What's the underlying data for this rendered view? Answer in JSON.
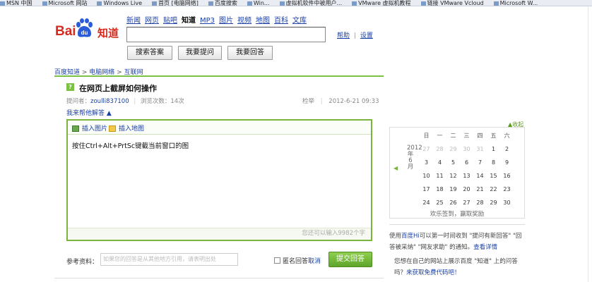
{
  "browser_tabs": [
    "MSN 中国",
    "Microsoft 网站",
    "Windows Live",
    "首页 [电脑网络]",
    "百度搜索",
    "Win...",
    "虚拟机软件中被用户...",
    "VMware 虚拟机教程",
    "链接 VMware Vcloud",
    "Microsoft W..."
  ],
  "logo": {
    "bai": "Bai",
    "du": "du",
    "zhidao": "知道"
  },
  "nav": [
    "新闻",
    "网页",
    "贴吧",
    "知道",
    "MP3",
    "图片",
    "视频",
    "地图",
    "百科",
    "文库"
  ],
  "search": {
    "value": ""
  },
  "help_links": {
    "help": "帮助",
    "sep": "|",
    "settings": "设置"
  },
  "buttons": {
    "search": "搜索答案",
    "ask": "我要提问",
    "answer": "我要回答"
  },
  "breadcrumb": {
    "home": "百度知道",
    "sep1": " > ",
    "cat": "电脑网络",
    "sep2": " > ",
    "sub": "互联网"
  },
  "question": {
    "icon": "?",
    "title": "在网页上截屏如何操作",
    "asker_label": "提问者：",
    "asker": "zoulli837100",
    "views": "浏览次数：14次",
    "report": "检举",
    "date": "2012-6-21 09:33"
  },
  "i_help": "我来帮他解答 ▲",
  "editor": {
    "insert_image": "插入图片",
    "insert_map": "插入地图",
    "content": "按住Ctrl+Alt+PrtSc键截当前窗口的图",
    "counter": "您还可以输入9982个字"
  },
  "reference": {
    "label": "参考资料：",
    "placeholder": "如果您的回答是从其他地方引用，请表明出处"
  },
  "anonymous": {
    "label": "匿名回答",
    "cancel": "取消"
  },
  "submit_label": "提交回答",
  "sidebar": {
    "collapse": "▲收起",
    "calendar": {
      "year": "2012年6月",
      "weekdays": [
        "日",
        "一",
        "二",
        "三",
        "四",
        "五",
        "六"
      ],
      "weeks": [
        [
          "27",
          "28",
          "29",
          "30",
          "31",
          "1",
          "2"
        ],
        [
          "3",
          "4",
          "5",
          "6",
          "7",
          "8",
          "9"
        ],
        [
          "10",
          "11",
          "12",
          "13",
          "14",
          "15",
          "16"
        ],
        [
          "17",
          "18",
          "19",
          "20",
          "21",
          "22",
          "23"
        ],
        [
          "24",
          "25",
          "26",
          "27",
          "28",
          "29",
          "30"
        ]
      ],
      "dim_first_row_until": 4,
      "signin": "欢乐签到，赢取奖励"
    },
    "promo1_a": "使用",
    "promo1_link": "百度Hi",
    "promo1_b": "可以第一时间收到 \"提问有新回答\" \"回答被采纳\" \"网友求助\" 的通知。",
    "promo1_more": "查看详情",
    "promo2_a": "您想在自己的网站上展示百度 \"知道\" 上的问答吗？",
    "promo2_link": "来获取免费代码吧！"
  }
}
